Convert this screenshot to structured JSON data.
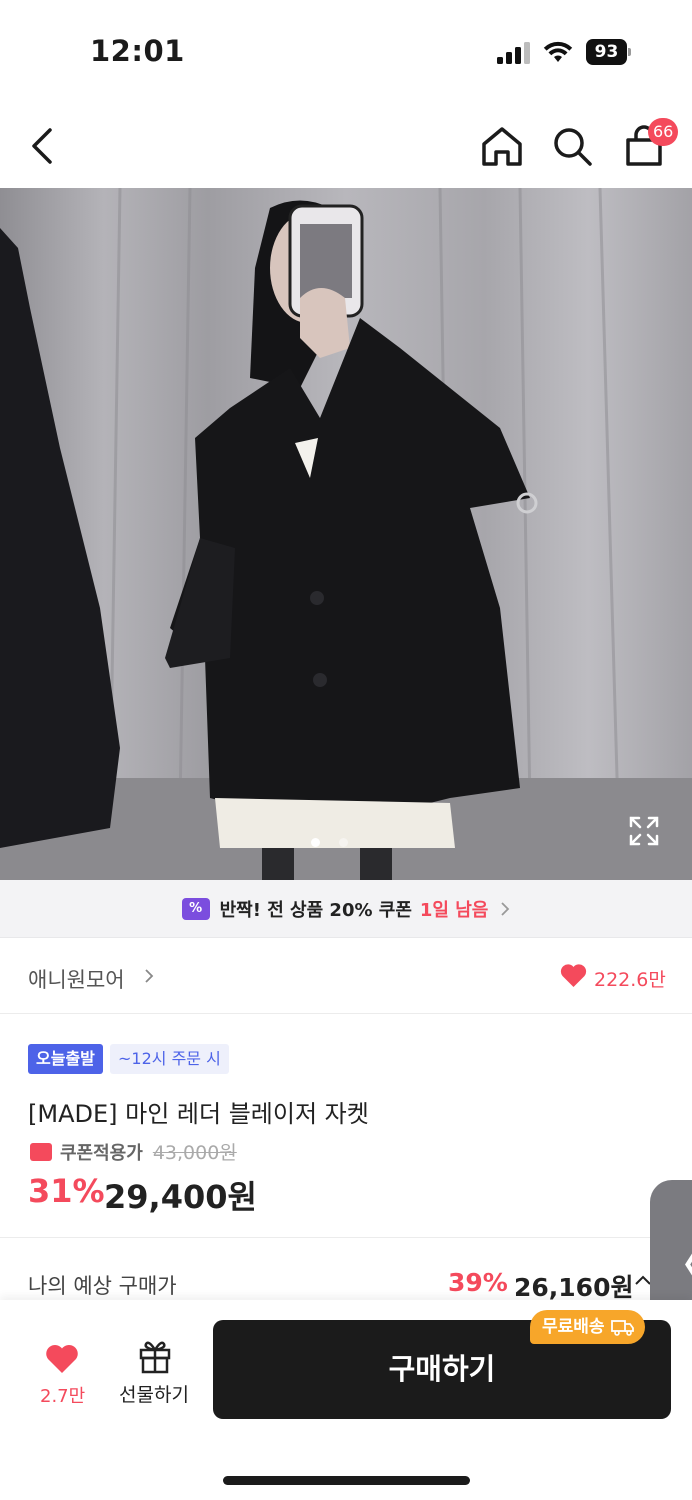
{
  "status": {
    "time": "12:01",
    "battery": "93"
  },
  "nav": {
    "cart_badge": "66"
  },
  "carousel": {
    "total_dots": 2,
    "active_index": 0
  },
  "coupon_banner": {
    "text": "반짝! 전 상품 20% 쿠폰",
    "remaining": "1일 남음",
    "icon": "%"
  },
  "store": {
    "name": "애니원모어",
    "likes": "222.6만"
  },
  "product": {
    "tag_today": "오늘출발",
    "tag_order": "~12시 주문 시",
    "name": "[MADE] 마인 레더 블레이저 자켓",
    "coupon_label": "쿠폰적용가",
    "original_price": "43,000원",
    "discount": "31%",
    "price": "29,400원"
  },
  "expected": {
    "label": "나의 예상 구매가",
    "discount": "39%",
    "price": "26,160원"
  },
  "side_handle": {
    "glyph": "〈"
  },
  "bottom": {
    "likes": "2.7만",
    "gift_label": "선물하기",
    "buy_label": "구매하기",
    "free_shipping": "무료배송"
  },
  "colors": {
    "accent": "#f44a5c",
    "primary_dark": "#1b1b1b",
    "today_tag": "#4d63e8",
    "coupon_purple": "#7b4dde",
    "shipping_orange": "#f7a62a"
  }
}
